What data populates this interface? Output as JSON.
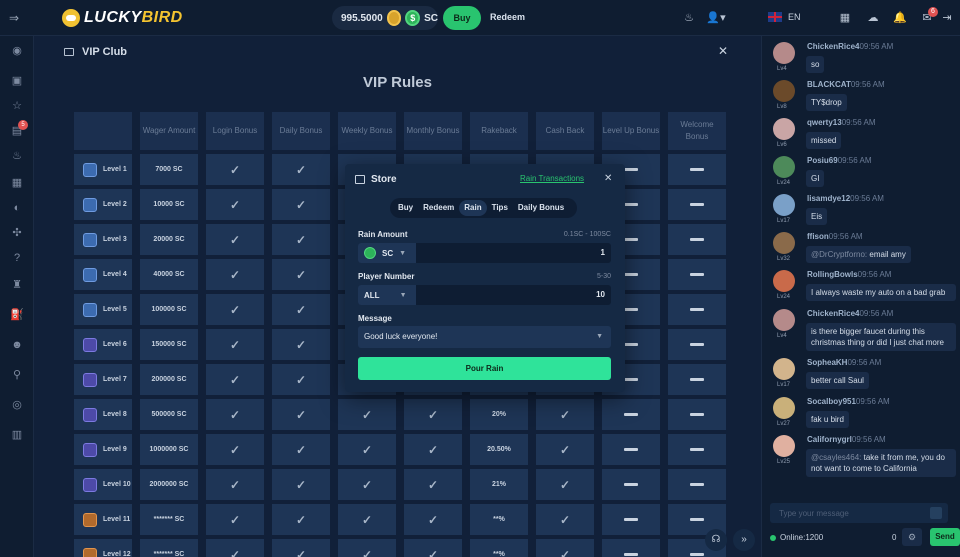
{
  "topbar": {
    "logo_lucky": "LUCKY",
    "logo_bird": "BIRD",
    "balance": "995.5000",
    "currency": "SC",
    "sc_glyph": "$",
    "buy": "Buy",
    "redeem": "Redeem",
    "language": "EN",
    "notif_count": "6"
  },
  "sidebar": {
    "store_badge": "5"
  },
  "vip": {
    "title": "VIP Club",
    "rules_heading": "VIP Rules",
    "headers": [
      "Wager Amount",
      "Login Bonus",
      "Daily Bonus",
      "Weekly Bonus",
      "Monthly Bonus",
      "Rakeback",
      "Cash Back",
      "Level Up Bonus",
      "Welcome Bonus"
    ],
    "rows": [
      {
        "level": "Level 1",
        "wager": "7000 SC",
        "tier": "blue",
        "cells": [
          "check",
          "check",
          "check",
          "check",
          "",
          "",
          "dash",
          "dash"
        ]
      },
      {
        "level": "Level 2",
        "wager": "10000 SC",
        "tier": "blue",
        "cells": [
          "check",
          "check",
          "check",
          "check",
          "",
          "",
          "dash",
          "dash"
        ]
      },
      {
        "level": "Level 3",
        "wager": "20000 SC",
        "tier": "blue",
        "cells": [
          "check",
          "check",
          "check",
          "check",
          "",
          "",
          "dash",
          "dash"
        ]
      },
      {
        "level": "Level 4",
        "wager": "40000 SC",
        "tier": "blue",
        "cells": [
          "check",
          "check",
          "check",
          "check",
          "",
          "",
          "dash",
          "dash"
        ]
      },
      {
        "level": "Level 5",
        "wager": "100000 SC",
        "tier": "blue",
        "cells": [
          "check",
          "check",
          "check",
          "check",
          "",
          "",
          "dash",
          "dash"
        ]
      },
      {
        "level": "Level 6",
        "wager": "150000 SC",
        "tier": "purple",
        "cells": [
          "check",
          "check",
          "check",
          "check",
          "",
          "",
          "dash",
          "dash"
        ]
      },
      {
        "level": "Level 7",
        "wager": "200000 SC",
        "tier": "purple",
        "cells": [
          "check",
          "check",
          "check",
          "check",
          "",
          "",
          "dash",
          "dash"
        ]
      },
      {
        "level": "Level 8",
        "wager": "500000 SC",
        "tier": "purple",
        "cells": [
          "check",
          "check",
          "check",
          "check",
          "20%",
          "check",
          "dash",
          "dash"
        ]
      },
      {
        "level": "Level 9",
        "wager": "1000000 SC",
        "tier": "purple",
        "cells": [
          "check",
          "check",
          "check",
          "check",
          "20.50%",
          "check",
          "dash",
          "dash"
        ]
      },
      {
        "level": "Level 10",
        "wager": "2000000 SC",
        "tier": "purple",
        "cells": [
          "check",
          "check",
          "check",
          "check",
          "21%",
          "check",
          "dash",
          "dash"
        ]
      },
      {
        "level": "Level 11",
        "wager": "******* SC",
        "tier": "gold",
        "cells": [
          "check",
          "check",
          "check",
          "check",
          "**%",
          "check",
          "dash",
          "dash"
        ]
      },
      {
        "level": "Level 12",
        "wager": "******* SC",
        "tier": "gold",
        "cells": [
          "check",
          "check",
          "check",
          "check",
          "**%",
          "check",
          "dash",
          "dash"
        ]
      }
    ]
  },
  "store": {
    "title": "Store",
    "rain_transactions": "Rain Transactions",
    "tabs": [
      "Buy",
      "Redeem",
      "Rain",
      "Tips",
      "Daily Bonus"
    ],
    "active_tab": "Rain",
    "rain_amount_label": "Rain Amount",
    "rain_amount_hint": "0.1SC - 100SC",
    "rain_currency": "SC",
    "rain_amount_value": "1",
    "player_number_label": "Player Number",
    "player_number_hint": "5-30",
    "player_filter": "ALL",
    "player_number_value": "10",
    "message_label": "Message",
    "message_value": "Good luck everyone!",
    "pour_button": "Pour Rain"
  },
  "chat": {
    "messages": [
      {
        "lv": "Lv4",
        "name": "ChickenRice4",
        "time": "09:56 AM",
        "text": "so",
        "color": "#b58a8a"
      },
      {
        "lv": "Lv8",
        "name": "BLACKCAT",
        "time": "09:56 AM",
        "text": "TY$drop",
        "color": "#6b4a2a"
      },
      {
        "lv": "Lv6",
        "name": "qwerty13",
        "time": "09:56 AM",
        "text": "missed",
        "color": "#c9a5a5"
      },
      {
        "lv": "Lv24",
        "name": "Posiu69",
        "time": "09:56 AM",
        "text": "GI",
        "color": "#4d8a5a"
      },
      {
        "lv": "Lv17",
        "name": "lisamdye12",
        "time": "09:56 AM",
        "text": "Eis",
        "color": "#7aa0c8"
      },
      {
        "lv": "Lv32",
        "name": "ffison",
        "time": "09:56 AM",
        "text_mention": "@DrCryptforno:",
        "text": "email amy",
        "color": "#8a6a4a"
      },
      {
        "lv": "Lv24",
        "name": "RollingBowls",
        "time": "09:56 AM",
        "text": "I always waste my auto on a bad grab",
        "color": "#c96a4a"
      },
      {
        "lv": "Lv4",
        "name": "ChickenRice4",
        "time": "09:56 AM",
        "text": "is there bigger faucet during this christmas thing or did I just chat more",
        "color": "#b58a8a"
      },
      {
        "lv": "Lv17",
        "name": "SopheaKH",
        "time": "09:56 AM",
        "text": "better call Saul",
        "color": "#d2b48c"
      },
      {
        "lv": "Lv27",
        "name": "Socalboy951",
        "time": "09:56 AM",
        "text": "fak u bird",
        "color": "#c9b07a"
      },
      {
        "lv": "Lv25",
        "name": "Californygrl",
        "time": "09:56 AM",
        "text_mention": "@csayles464:",
        "text": "take it from me, you do not want to come to California",
        "color": "#e0b0a0"
      }
    ],
    "input_placeholder": "Type your message",
    "online": "Online:1200",
    "zero": "0",
    "send": "Send"
  }
}
